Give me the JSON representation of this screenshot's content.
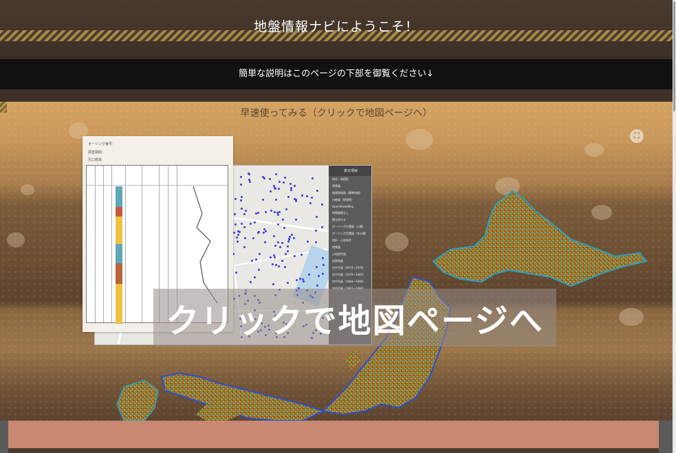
{
  "header": {
    "title": "地盤情報ナビにようこそ！"
  },
  "notice": {
    "text": "簡単な説明はこのページの下部を御覧ください↓"
  },
  "hero": {
    "quick_link": "早速使ってみる（クリックで地図ページへ）",
    "cta": "クリックで地図ページへ"
  },
  "paper": {
    "line1": "ボーリング番号：",
    "line2": "調査期間：",
    "line3": "孔口標高",
    "footnote": ""
  },
  "map_panel": {
    "title": "表示項目",
    "subtitle": "地名：新宿区",
    "items": [
      "背景図",
      "地理院地図（標準地図）",
      "白地図（地理院）",
      "OpenStreetMap",
      "地図描画なし",
      "重ね合わせ",
      "ボーリング位置図（公開）",
      "ボーリング位置図（非公開）",
      "地形・土地条件",
      "地質図",
      "土地条件図",
      "旧版地図",
      "空中写真（1974〜1978）",
      "空中写真（1979〜1983）",
      "空中写真（1984〜1986）",
      "空中写真（1987〜1990）"
    ]
  },
  "colors": {
    "soil_top": "#d4a463",
    "header_bg": "#3c2f25",
    "cta_overlay": "#968c87",
    "salmon": "#c88872"
  },
  "icons": {
    "expand": "expand-icon"
  }
}
